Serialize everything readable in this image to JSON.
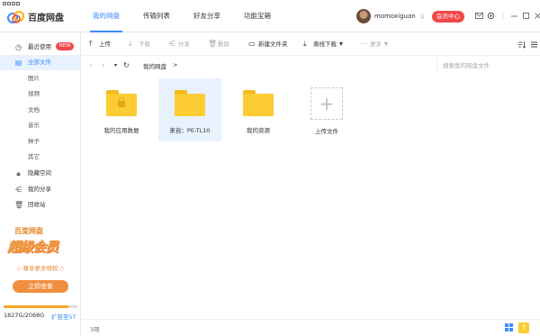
{
  "app": {
    "name": "百度网盘"
  },
  "topnav": {
    "tabs": [
      "我的网盘",
      "传输列表",
      "好友分享",
      "功能宝箱"
    ]
  },
  "user": {
    "name": "momoxiguan",
    "vip_button": "会员中心"
  },
  "sidebar": {
    "items": [
      {
        "label": "最近使用",
        "icon": "clock-icon"
      },
      {
        "label": "全部文件",
        "icon": "file-icon"
      },
      {
        "label": "图片"
      },
      {
        "label": "视频"
      },
      {
        "label": "文档"
      },
      {
        "label": "音乐"
      },
      {
        "label": "种子"
      },
      {
        "label": "其它"
      },
      {
        "label": "隐藏空间",
        "icon": "lock-icon"
      },
      {
        "label": "我的分享",
        "icon": "share-icon"
      },
      {
        "label": "回收站",
        "icon": "trash-icon"
      }
    ],
    "new_badge": "NEW",
    "promo": {
      "title": "百度网盘",
      "headline": "超级会员",
      "subtitle": "◇ 尊享更多特权 ◇",
      "button": "立即查看"
    },
    "storage": {
      "text": "1827G/2068G",
      "used_fraction": 0.883,
      "expand": "扩容至5T"
    }
  },
  "toolbar": {
    "upload": "上传",
    "download": "下载",
    "share": "分享",
    "delete": "删除",
    "new_folder": "新建文件夹",
    "offline_download": "离线下载",
    "more": "更多"
  },
  "pathbar": {
    "crumb": "我的网盘",
    "crumb_sep": ">",
    "search_placeholder": "搜索我的网盘文件"
  },
  "files": [
    {
      "name": "我的应用数据",
      "type": "folder-locked"
    },
    {
      "name": "来自：PE-TL10",
      "type": "folder",
      "selected": true
    },
    {
      "name": "我的资源",
      "type": "folder"
    }
  ],
  "upload_tile": {
    "label": "上传文件"
  },
  "status": {
    "count": "3项"
  },
  "colors": {
    "accent": "#3b8cff",
    "vip": "#f24848",
    "folder": "#fccc33"
  }
}
